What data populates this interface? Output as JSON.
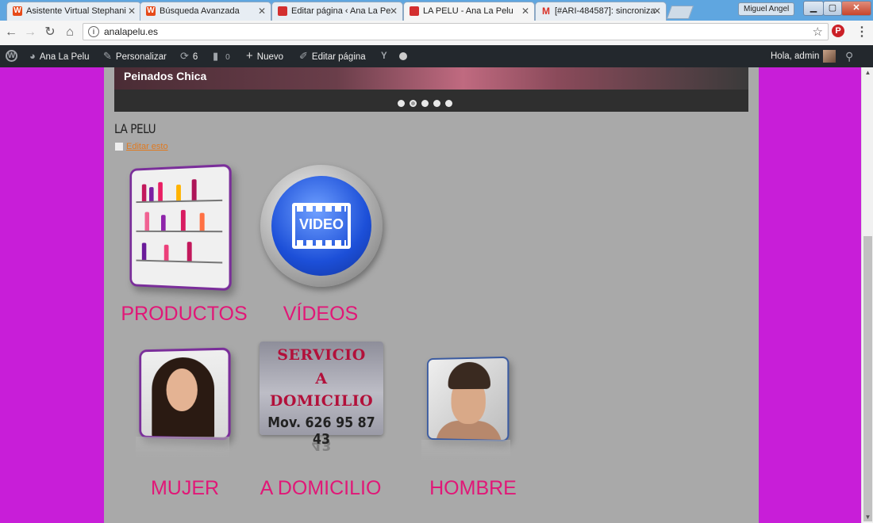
{
  "browser": {
    "tabs": [
      {
        "title": "Asistente Virtual Stephani",
        "favicon": "W",
        "favicon_color": "#e64a19"
      },
      {
        "title": "Búsqueda Avanzada",
        "favicon": "W",
        "favicon_color": "#e64a19"
      },
      {
        "title": "Editar página ‹ Ana La Pe",
        "favicon": "",
        "favicon_color": "#d32f2f"
      },
      {
        "title": "LA PELU - Ana La Pelu",
        "favicon": "",
        "favicon_color": "#d32f2f"
      },
      {
        "title": "[#ARI-484587]: sincroniza",
        "favicon": "M",
        "favicon_color": "#d93025"
      }
    ],
    "user_name": "Miguel Angel",
    "url": "analapelu.es"
  },
  "admin_bar": {
    "site_name": "Ana La Pelu",
    "customize": "Personalizar",
    "updates_count": "6",
    "comments_count": "0",
    "new_label": "Nuevo",
    "edit_page": "Editar página",
    "greeting": "Hola, admin"
  },
  "page": {
    "slide_caption": "Peinados Chica",
    "slider_dots": 5,
    "site_title": "LA PELU",
    "edit_link": "Editar esto",
    "tiles": [
      {
        "label": "PRODUCTOS"
      },
      {
        "label": "VÍDEOS",
        "button_text": "VIDEO"
      },
      {
        "label": "MUJER"
      },
      {
        "label": "A DOMICILIO",
        "sign_lines": [
          "SERVICIO",
          "A",
          "DOMICILIO"
        ],
        "sign_phone": "Mov. 626 95 87 43"
      },
      {
        "label": "HOMBRE"
      }
    ]
  },
  "colors": {
    "page_background": "#c81ed8",
    "content_background": "#a9a9a9",
    "label_color": "#e11777",
    "admin_bar": "#23282d"
  }
}
